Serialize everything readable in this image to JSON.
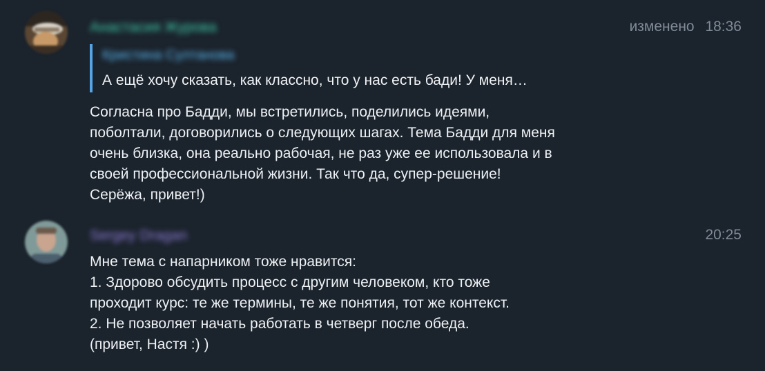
{
  "messages": [
    {
      "sender": "Анастасия Журова",
      "edited_label": "изменено",
      "time": "18:36",
      "reply": {
        "author": "Кристина Султанова",
        "text": "А ещё хочу сказать, как классно, что у нас есть бади! У меня…"
      },
      "lines": [
        "Согласна про Бадди, мы встретились, поделились идеями,",
        "поболтали, договорились о следующих шагах. Тема Бадди для меня",
        "очень близка, она реально рабочая, не раз уже ее использовала и в",
        "своей профессиональной жизни. Так что да, супер-решение!",
        "Серёжа, привет!)"
      ]
    },
    {
      "sender": "Sergey Dragan",
      "time": "20:25",
      "lines": [
        "Мне тема с напарником тоже нравится:",
        "1. Здорово обсудить процесс с другим человеком, кто тоже",
        "проходит курс: те же термины, те же понятия, тот же контекст.",
        "2. Не позволяет начать работать в четверг после обеда.",
        "(привет, Настя :) )"
      ]
    }
  ]
}
